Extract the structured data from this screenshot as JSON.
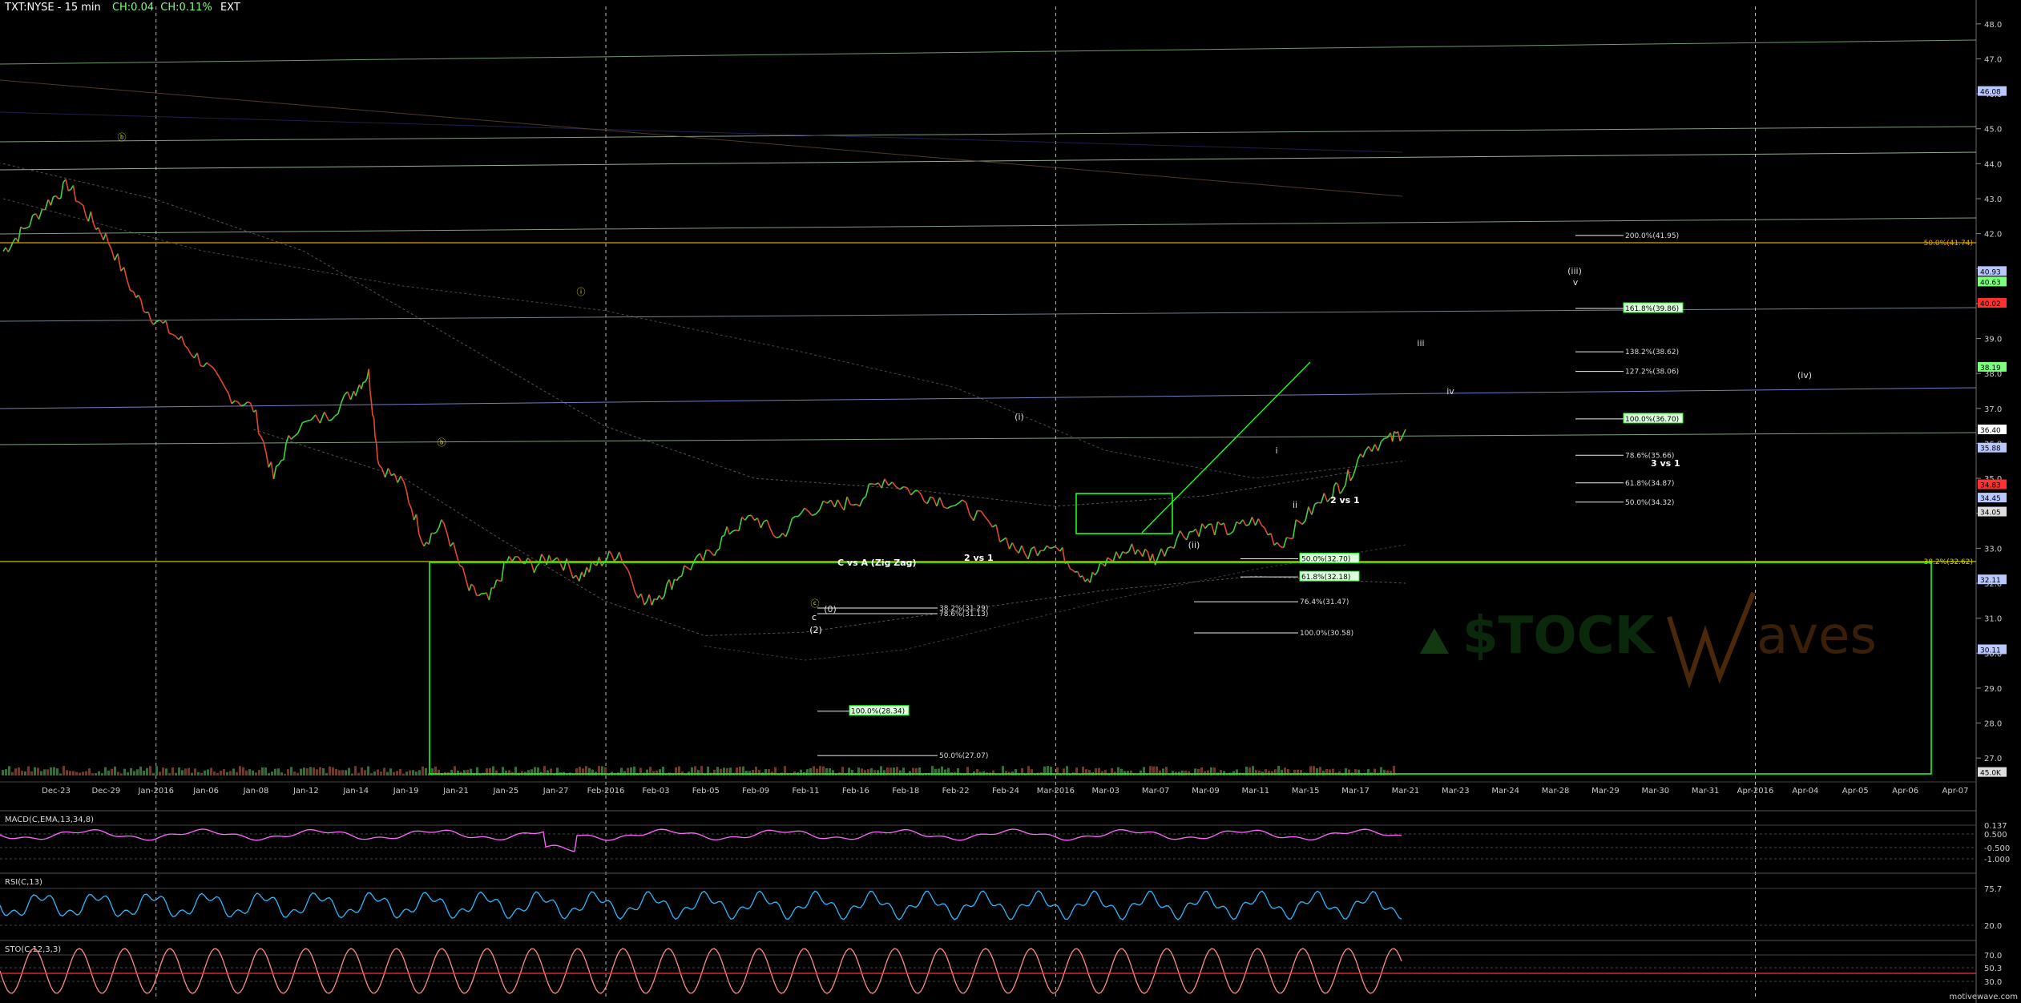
{
  "header": {
    "symbol": "TXT:NYSE - 15 min",
    "ch": "CH:0.04",
    "chpct": "CH:0.11%",
    "ext": "EXT"
  },
  "footer": "motivewave.com",
  "colors": {
    "background": "#000000",
    "price_up": "#3fd23f",
    "price_down": "#e04a2a",
    "fib_box": "#19ff19",
    "macd": "#ff66ff",
    "rsi": "#2ab8ff",
    "sto": "#ff8a8a",
    "yellow_line": "#d8d800",
    "orange_line": "#e0a000"
  },
  "chart_data": [
    {
      "type": "line",
      "title": "TXT:NYSE - 15 min",
      "ylim": [
        26.5,
        48.5
      ],
      "y_ticks": [
        "27.0",
        "28.0",
        "29.0",
        "30.0",
        "31.0",
        "32.0",
        "33.0",
        "34.0",
        "35.0",
        "36.0",
        "37.0",
        "38.0",
        "39.0",
        "40.0",
        "41.0",
        "42.0",
        "43.0",
        "44.0",
        "45.0",
        "46.0",
        "47.0",
        "48.0"
      ],
      "x_ticks": [
        "Dec-23",
        "Dec-29",
        "Jan-2016",
        "Jan-06",
        "Jan-08",
        "Jan-12",
        "Jan-14",
        "Jan-19",
        "Jan-21",
        "Jan-25",
        "Jan-27",
        "Feb-2016",
        "Feb-03",
        "Feb-05",
        "Feb-09",
        "Feb-11",
        "Feb-16",
        "Feb-18",
        "Feb-22",
        "Feb-24",
        "Mar-2016",
        "Mar-03",
        "Mar-07",
        "Mar-09",
        "Mar-11",
        "Mar-15",
        "Mar-17",
        "Mar-21",
        "Mar-23",
        "Mar-24",
        "Mar-28",
        "Mar-29",
        "Mar-30",
        "Mar-31",
        "Apr-2016",
        "Apr-04",
        "Apr-05",
        "Apr-06",
        "Apr-07"
      ],
      "price_path": [
        [
          0,
          41.5
        ],
        [
          0.4,
          42.1
        ],
        [
          0.9,
          42.9
        ],
        [
          1.3,
          43.4
        ],
        [
          1.7,
          42.5
        ],
        [
          2.1,
          41.8
        ],
        [
          2.6,
          40.3
        ],
        [
          3.0,
          39.6
        ],
        [
          3.5,
          39.0
        ],
        [
          4.0,
          38.3
        ],
        [
          4.5,
          37.4
        ],
        [
          5.0,
          37.0
        ],
        [
          5.4,
          35.0
        ],
        [
          5.8,
          36.4
        ],
        [
          6.5,
          36.8
        ],
        [
          7.0,
          37.5
        ],
        [
          7.3,
          38.0
        ],
        [
          7.5,
          35.4
        ],
        [
          8.0,
          34.8
        ],
        [
          8.4,
          33.2
        ],
        [
          8.8,
          33.7
        ],
        [
          9.3,
          31.8
        ],
        [
          9.7,
          31.5
        ],
        [
          10.1,
          32.7
        ],
        [
          10.6,
          32.5
        ],
        [
          11.0,
          32.8
        ],
        [
          11.5,
          32.2
        ],
        [
          11.9,
          32.6
        ],
        [
          12.3,
          32.9
        ],
        [
          12.8,
          31.4
        ],
        [
          13.2,
          31.8
        ],
        [
          13.6,
          32.4
        ],
        [
          14.1,
          32.8
        ],
        [
          14.5,
          33.5
        ],
        [
          15.0,
          33.9
        ],
        [
          15.5,
          33.3
        ],
        [
          16.0,
          34.1
        ],
        [
          16.6,
          34.2
        ],
        [
          17.1,
          34.4
        ],
        [
          17.6,
          35.0
        ],
        [
          18.2,
          34.6
        ],
        [
          18.7,
          34.4
        ],
        [
          19.3,
          34.1
        ],
        [
          19.9,
          33.4
        ],
        [
          20.4,
          32.8
        ],
        [
          20.9,
          33.2
        ],
        [
          21.3,
          32.6
        ],
        [
          21.7,
          32.1
        ],
        [
          22.1,
          32.7
        ],
        [
          22.6,
          33.0
        ],
        [
          23.0,
          32.7
        ],
        [
          23.5,
          33.4
        ],
        [
          24.0,
          33.6
        ],
        [
          24.5,
          33.5
        ],
        [
          25.0,
          33.8
        ],
        [
          25.5,
          33.1
        ],
        [
          26.0,
          33.9
        ],
        [
          26.5,
          34.6
        ],
        [
          26.8,
          34.9
        ],
        [
          27.2,
          35.9
        ],
        [
          27.7,
          36.1
        ],
        [
          28.0,
          36.4
        ]
      ],
      "labels_wave": [
        "(i)",
        "(ii)",
        "(iii)",
        "(iv)",
        "iii",
        "iv",
        "v",
        "i",
        "ii",
        "c",
        "(0)",
        "(2)",
        "ⓑ",
        "ⓒ",
        "ⓑ",
        "ⓘ"
      ],
      "fib_levels_right": [
        {
          "label": "200.0%(41.95)",
          "value": 41.95
        },
        {
          "label": "161.8%(39.86)",
          "value": 39.86
        },
        {
          "label": "138.2%(38.62)",
          "value": 38.62
        },
        {
          "label": "127.2%(38.06)",
          "value": 38.06
        },
        {
          "label": "100.0%(36.70)",
          "value": 36.7
        },
        {
          "label": "78.6%(35.66)",
          "value": 35.66
        },
        {
          "label": "61.8%(34.87)",
          "value": 34.87
        },
        {
          "label": "50.0%(34.32)",
          "value": 34.32
        }
      ],
      "fib_levels_mid": [
        {
          "label": "50.0%(32.70)",
          "value": 32.7
        },
        {
          "label": "61.8%(32.18)",
          "value": 32.18
        },
        {
          "label": "76.4%(31.47)",
          "value": 31.47
        },
        {
          "label": "100.0%(30.58)",
          "value": 30.58
        }
      ],
      "fib_levels_left": [
        {
          "label": "78.6%(31.13)",
          "value": 31.13
        },
        {
          "label": "38.2%(31.29)",
          "value": 31.29
        },
        {
          "label": "100.0%(28.34)",
          "value": 28.34
        },
        {
          "label": "50.0%(27.07)",
          "value": 27.07
        }
      ],
      "annotations": [
        "C vs A (Zig Zag)",
        "2 vs 1",
        "2 vs 1",
        "3 vs 1"
      ],
      "horizontal_levels": [
        {
          "label": "50.0%(41.74)",
          "value": 41.74
        },
        {
          "label": "38.2%(32.62)",
          "value": 32.62
        }
      ],
      "right_axis_tags": [
        {
          "label": "46.08",
          "value": 46.08,
          "color": "#b8c8ff"
        },
        {
          "label": "40.93",
          "value": 40.93,
          "color": "#b8c8ff"
        },
        {
          "label": "40.63",
          "value": 40.63,
          "color": "#7dff7d"
        },
        {
          "label": "40.02",
          "value": 40.02,
          "color": "#ff3030"
        },
        {
          "label": "38.19",
          "value": 38.19,
          "color": "#7dff7d"
        },
        {
          "label": "36.40",
          "value": 36.4,
          "color": "#ffffff"
        },
        {
          "label": "35.88",
          "value": 35.88,
          "color": "#b8c8ff"
        },
        {
          "label": "34.83",
          "value": 34.83,
          "color": "#ff3030"
        },
        {
          "label": "34.45",
          "value": 34.45,
          "color": "#b8c8ff"
        },
        {
          "label": "34.05",
          "value": 34.05,
          "color": "#dddddd"
        },
        {
          "label": "32.11",
          "value": 32.11,
          "color": "#b8c8ff"
        },
        {
          "label": "30.11",
          "value": 30.11,
          "color": "#b8c8ff"
        },
        {
          "label": "45.0K",
          "value": 26.6,
          "color": "#dddddd"
        }
      ]
    },
    {
      "type": "line",
      "title": "MACD(C,EMA,13,34,8)",
      "ticks": [
        "0.137",
        "0.500",
        "-0.500",
        "-1.000"
      ]
    },
    {
      "type": "line",
      "title": "RSI(C,13)",
      "ticks": [
        "75.7",
        "20.0"
      ]
    },
    {
      "type": "line",
      "title": "STO(C,12,3,3)",
      "ticks": [
        "70.0",
        "50.3",
        "30.0"
      ]
    }
  ],
  "watermark": {
    "left": "$TOCK",
    "right": "aves"
  }
}
